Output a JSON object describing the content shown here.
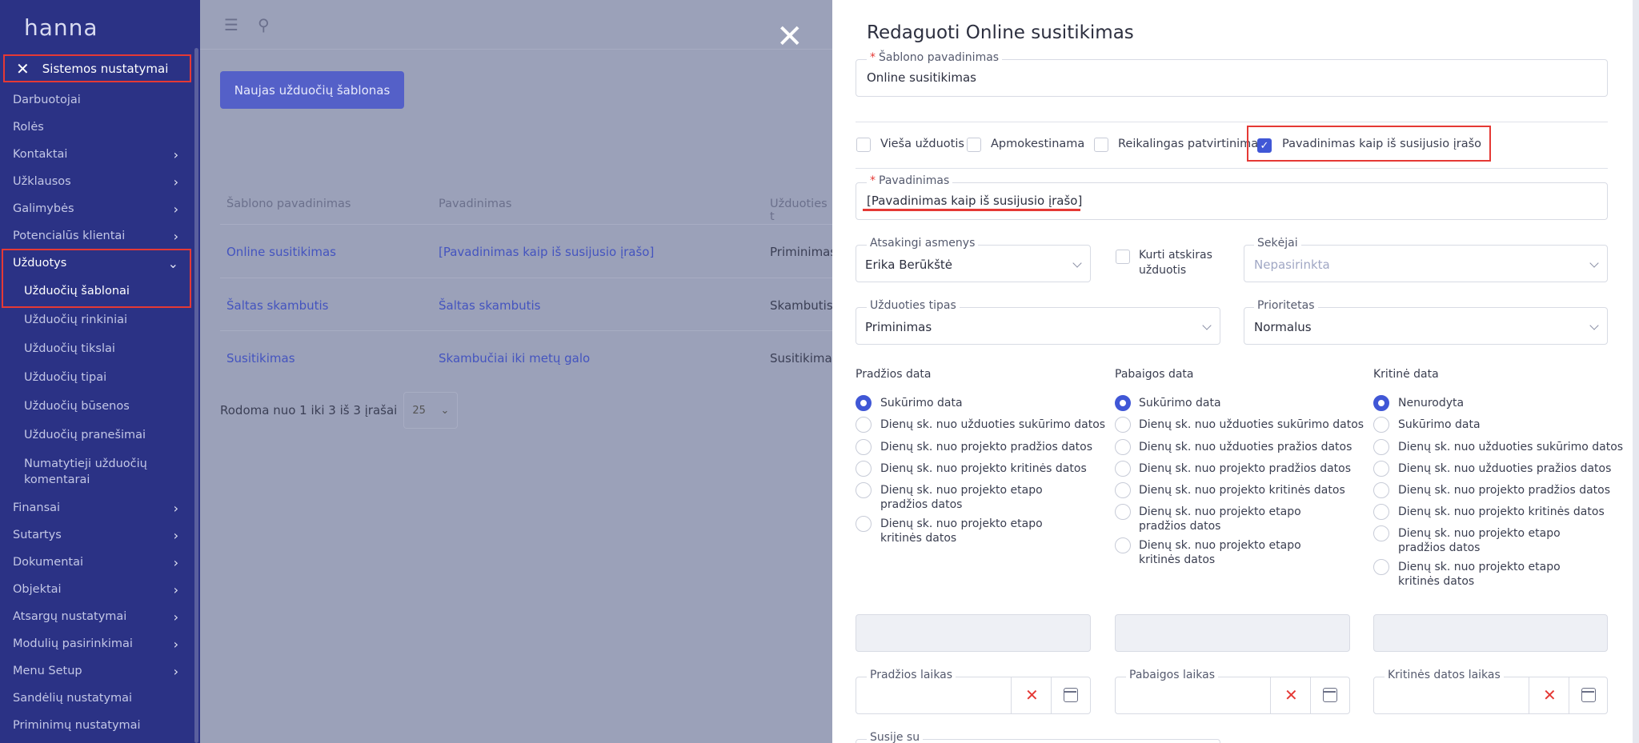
{
  "sidebar": {
    "brand": "hanna",
    "section_title": "Sistemos nustatymai",
    "items": [
      {
        "label": "Darbuotojai",
        "chev": ""
      },
      {
        "label": "Rolės",
        "chev": ""
      },
      {
        "label": "Kontaktai",
        "chev": "›"
      },
      {
        "label": "Užklausos",
        "chev": "›"
      },
      {
        "label": "Galimybės",
        "chev": "›"
      },
      {
        "label": "Potencialūs klientai",
        "chev": "›"
      },
      {
        "label": "Užduotys",
        "chev": "⌄"
      }
    ],
    "subitems": [
      "Užduočių šablonai",
      "Užduočių rinkiniai",
      "Užduočių tikslai",
      "Užduočių tipai",
      "Užduočių būsenos",
      "Užduočių pranešimai",
      "Numatytieji užduočių komentarai"
    ],
    "items_after": [
      {
        "label": "Finansai",
        "chev": "›"
      },
      {
        "label": "Sutartys",
        "chev": "›"
      },
      {
        "label": "Dokumentai",
        "chev": "›"
      },
      {
        "label": "Objektai",
        "chev": "›"
      },
      {
        "label": "Atsargų nustatymai",
        "chev": "›"
      },
      {
        "label": "Modulių pasirinkimai",
        "chev": "›"
      },
      {
        "label": "Menu Setup",
        "chev": "›"
      },
      {
        "label": "Sandėlių nustatymai",
        "chev": ""
      },
      {
        "label": "Priminimų nustatymai",
        "chev": ""
      }
    ]
  },
  "main": {
    "new_button": "Naujas užduočių šablonas",
    "columns": [
      "Šablono pavadinimas",
      "Pavadinimas",
      "Užduoties t"
    ],
    "rows": [
      [
        "Online susitikimas",
        "[Pavadinimas kaip iš susijusio įrašo]",
        "Priminimas"
      ],
      [
        "Šaltas skambutis",
        "Šaltas skambutis",
        "Skambutis"
      ],
      [
        "Susitikimas",
        "Skambučiai iki metų galo",
        "Susitikimas"
      ]
    ],
    "pager_text": "Rodoma nuo 1 iki 3 iš 3 įrašai",
    "page_size": "25"
  },
  "drawer": {
    "title": "Redaguoti Online susitikimas",
    "template_name_label": "Šablono pavadinimas",
    "template_name_value": "Online susitikimas",
    "checkboxes": [
      {
        "label": "Vieša užduotis",
        "checked": false
      },
      {
        "label": "Apmokestinama",
        "checked": false
      },
      {
        "label": "Reikalingas patvirtinimas",
        "checked": false
      },
      {
        "label": "Pavadinimas kaip iš susijusio įrašo",
        "checked": true
      }
    ],
    "name_label": "Pavadinimas",
    "name_value": "[Pavadinimas kaip iš susijusio įrašo]",
    "responsible_label": "Atsakingi asmenys",
    "responsible_value": "Erika Berūkštė",
    "separate_task_label": "Kurti atskiras užduotis",
    "followers_label": "Sekėjai",
    "followers_placeholder": "Nepasirinkta",
    "type_label": "Užduoties tipas",
    "type_value": "Priminimas",
    "priority_label": "Prioritetas",
    "priority_value": "Normalus",
    "start": {
      "title": "Pradžios data",
      "options": [
        "Sukūrimo data",
        "Dienų sk. nuo užduoties sukūrimo datos",
        "Dienų sk. nuo projekto pradžios datos",
        "Dienų sk. nuo projekto kritinės datos",
        "Dienų sk. nuo projekto etapo pradžios datos",
        "Dienų sk. nuo projekto etapo kritinės datos"
      ]
    },
    "end": {
      "title": "Pabaigos data",
      "options": [
        "Sukūrimo data",
        "Dienų sk. nuo užduoties sukūrimo datos",
        "Dienų sk. nuo užduoties pražios datos",
        "Dienų sk. nuo projekto pradžios datos",
        "Dienų sk. nuo projekto kritinės datos",
        "Dienų sk. nuo projekto etapo pradžios datos",
        "Dienų sk. nuo projekto etapo kritinės datos"
      ]
    },
    "critical": {
      "title": "Kritinė data",
      "options": [
        "Nenurodyta",
        "Sukūrimo data",
        "Dienų sk. nuo užduoties sukūrimo datos",
        "Dienų sk. nuo užduoties pražios datos",
        "Dienų sk. nuo projekto pradžios datos",
        "Dienų sk. nuo projekto kritinės datos",
        "Dienų sk. nuo projekto etapo pradžios datos",
        "Dienų sk. nuo projekto etapo kritinės datos"
      ]
    },
    "start_time_label": "Pradžios laikas",
    "end_time_label": "Pabaigos laikas",
    "critical_time_label": "Kritinės datos laikas",
    "related_label": "Susije su"
  },
  "colors": {
    "accent": "#4057d6",
    "sidebar": "#2b3285",
    "highlight": "#e53935"
  }
}
